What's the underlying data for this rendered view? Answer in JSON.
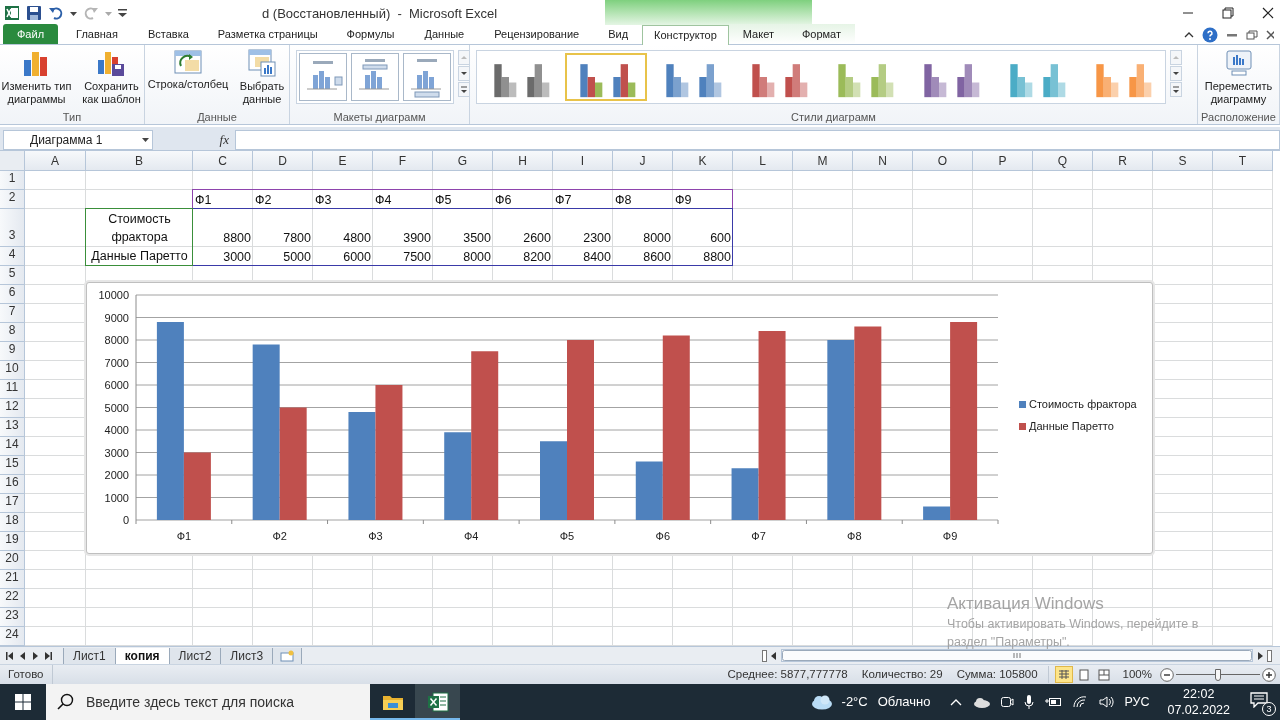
{
  "window": {
    "title": "d (Восстановленный)  -  Microsoft Excel"
  },
  "ribbon": {
    "tabs": [
      {
        "label": "Файл",
        "kind": "file",
        "selected": false
      },
      {
        "label": "Главная",
        "kind": "normal",
        "selected": false
      },
      {
        "label": "Вставка",
        "kind": "normal",
        "selected": false
      },
      {
        "label": "Разметка страницы",
        "kind": "normal",
        "selected": false
      },
      {
        "label": "Формулы",
        "kind": "normal",
        "selected": false
      },
      {
        "label": "Данные",
        "kind": "normal",
        "selected": false
      },
      {
        "label": "Рецензирование",
        "kind": "normal",
        "selected": false
      },
      {
        "label": "Вид",
        "kind": "normal",
        "selected": false
      },
      {
        "label": "Конструктор",
        "kind": "contextual",
        "selected": true
      },
      {
        "label": "Макет",
        "kind": "contextual",
        "selected": false
      },
      {
        "label": "Формат",
        "kind": "contextual",
        "selected": false
      }
    ],
    "groups": [
      {
        "label": "Тип",
        "kind": "buttons",
        "buttons": [
          {
            "label": "Изменить тип диаграммы",
            "kind": "change-type"
          },
          {
            "label": "Сохранить как шаблон",
            "kind": "save-template"
          }
        ]
      },
      {
        "label": "Данные",
        "kind": "buttons",
        "buttons": [
          {
            "label": "Строка/столбец",
            "kind": "switch"
          },
          {
            "label": "Выбрать данные",
            "kind": "select-data"
          }
        ]
      },
      {
        "label": "Макеты диаграмм",
        "kind": "layouts",
        "items": [
          {
            "kind": "legend-right"
          },
          {
            "kind": "labels-top"
          },
          {
            "kind": "labels-bottom"
          }
        ]
      },
      {
        "label": "Стили диаграмм",
        "kind": "styles",
        "items": [
          {
            "kind": "mono",
            "color": "#6b6b6b",
            "selected": false
          },
          {
            "kind": "multi",
            "color": "#4f81bd",
            "selected": true
          },
          {
            "kind": "mono",
            "color": "#4f81bd",
            "selected": false
          },
          {
            "kind": "mono",
            "color": "#c0504d",
            "selected": false
          },
          {
            "kind": "mono",
            "color": "#9bbb59",
            "selected": false
          },
          {
            "kind": "mono",
            "color": "#8064a2",
            "selected": false
          },
          {
            "kind": "mono",
            "color": "#4bacc6",
            "selected": false
          },
          {
            "kind": "mono",
            "color": "#f79646",
            "selected": false
          }
        ]
      },
      {
        "label": "Расположение",
        "kind": "buttons",
        "buttons": [
          {
            "label": "Переместить диаграмму",
            "kind": "move"
          }
        ]
      }
    ]
  },
  "formula_bar": {
    "name_box": "Диаграмма 1",
    "function_label": "fx"
  },
  "sheet": {
    "columns": [
      "A",
      "B",
      "C",
      "D",
      "E",
      "F",
      "G",
      "H",
      "I",
      "J",
      "K",
      "L",
      "M",
      "N",
      "O",
      "P",
      "Q",
      "R",
      "S",
      "T"
    ],
    "row_numbers": [
      "1",
      "2",
      "3",
      "4",
      "5",
      "6",
      "7",
      "8",
      "9",
      "10",
      "11",
      "12",
      "13",
      "14",
      "15",
      "16",
      "17",
      "18",
      "19",
      "20",
      "21",
      "22",
      "23",
      "24"
    ],
    "table": {
      "header": [
        "Ф1",
        "Ф2",
        "Ф3",
        "Ф4",
        "Ф5",
        "Ф6",
        "Ф7",
        "Ф8",
        "Ф9"
      ],
      "rows": [
        {
          "label": "Стоимость фрактора",
          "values": [
            "8800",
            "7800",
            "4800",
            "3900",
            "3500",
            "2600",
            "2300",
            "8000",
            "600"
          ]
        },
        {
          "label": "Данные Паретто",
          "values": [
            "3000",
            "5000",
            "6000",
            "7500",
            "8000",
            "8200",
            "8400",
            "8600",
            "8800"
          ]
        }
      ]
    },
    "range_highlights": [
      {
        "kind": "categories",
        "color": "#8e44ad"
      },
      {
        "kind": "values",
        "color": "#3a3aa8"
      },
      {
        "kind": "series_names",
        "color": "#3a8f3a"
      }
    ]
  },
  "chart": {
    "chart_data": {
      "type": "bar",
      "categories": [
        "Ф1",
        "Ф2",
        "Ф3",
        "Ф4",
        "Ф5",
        "Ф6",
        "Ф7",
        "Ф8",
        "Ф9"
      ],
      "series": [
        {
          "name": "Стоимость фрактора",
          "color": "#4f81bd",
          "values": [
            8800,
            7800,
            4800,
            3900,
            3500,
            2600,
            2300,
            8000,
            600
          ]
        },
        {
          "name": "Данные Паретто",
          "color": "#c0504d",
          "values": [
            3000,
            5000,
            6000,
            7500,
            8000,
            8200,
            8400,
            8600,
            8800
          ]
        }
      ],
      "grid": true,
      "legend": true,
      "ylim": [
        0,
        10000
      ],
      "yticks": [
        {
          "value": 0,
          "label": "0"
        },
        {
          "value": 1000,
          "label": "1000"
        },
        {
          "value": 2000,
          "label": "2000"
        },
        {
          "value": 3000,
          "label": "3000"
        },
        {
          "value": 4000,
          "label": "4000"
        },
        {
          "value": 5000,
          "label": "5000"
        },
        {
          "value": 6000,
          "label": "6000"
        },
        {
          "value": 7000,
          "label": "7000"
        },
        {
          "value": 8000,
          "label": "8000"
        },
        {
          "value": 9000,
          "label": "9000"
        },
        {
          "value": 10000,
          "label": "10000"
        }
      ]
    }
  },
  "sheet_tabs": [
    {
      "label": "Лист1",
      "selected": false
    },
    {
      "label": "копия",
      "selected": true
    },
    {
      "label": "Лист2",
      "selected": false
    },
    {
      "label": "Лист3",
      "selected": false
    }
  ],
  "status_bar": {
    "mode": "Готово",
    "stats": [
      "Среднее: 5877,777778",
      "Количество: 29",
      "Сумма: 105800"
    ],
    "views": [
      {
        "kind": "normal",
        "selected": true
      },
      {
        "kind": "layout",
        "selected": false
      },
      {
        "kind": "page-break",
        "selected": false
      }
    ],
    "zoom": "100%",
    "zoom_slider": {
      "level": 0.5
    }
  },
  "activation": {
    "title": "Активация Windows",
    "lines": [
      "Чтобы активировать Windows, перейдите в",
      "раздел \"Параметры\"."
    ]
  },
  "taskbar": {
    "search_placeholder": "Введите здесь текст для поиска",
    "apps": [
      {
        "kind": "explorer",
        "selected": false
      },
      {
        "kind": "excel",
        "selected": true
      }
    ],
    "temperature": "-2°C",
    "weather": "Облачно",
    "language": "РУС",
    "time": "22:02",
    "date": "07.02.2022",
    "notifications": "3"
  }
}
